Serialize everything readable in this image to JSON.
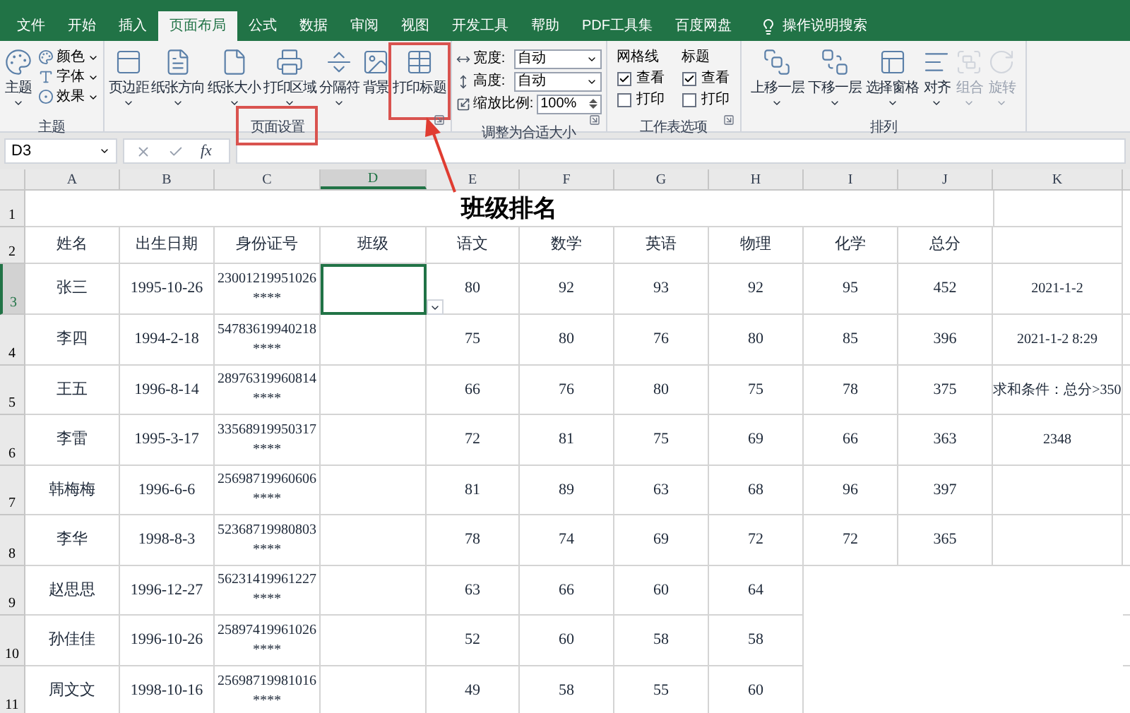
{
  "tabs": [
    {
      "label": "文件",
      "selected": false
    },
    {
      "label": "开始",
      "selected": false
    },
    {
      "label": "插入",
      "selected": false
    },
    {
      "label": "页面布局",
      "selected": true
    },
    {
      "label": "公式",
      "selected": false
    },
    {
      "label": "数据",
      "selected": false
    },
    {
      "label": "审阅",
      "selected": false
    },
    {
      "label": "视图",
      "selected": false
    },
    {
      "label": "开发工具",
      "selected": false
    },
    {
      "label": "帮助",
      "selected": false
    },
    {
      "label": "PDF工具集",
      "selected": false
    },
    {
      "label": "百度网盘",
      "selected": false
    }
  ],
  "tell_me": "操作说明搜索",
  "ribbon": {
    "theme_group": {
      "title": "主题",
      "main": "主题",
      "small": [
        "颜色",
        "字体",
        "效果"
      ]
    },
    "page_setup_group": {
      "title": "页面设置",
      "title_highlighted": true,
      "buttons": [
        {
          "label": "页边距",
          "has_menu": true,
          "highlighted": false
        },
        {
          "label": "纸张方向",
          "has_menu": true,
          "highlighted": false
        },
        {
          "label": "纸张大小",
          "has_menu": true,
          "highlighted": false
        },
        {
          "label": "打印区域",
          "has_menu": true,
          "highlighted": false
        },
        {
          "label": "分隔符",
          "has_menu": true,
          "highlighted": false
        },
        {
          "label": "背景",
          "has_menu": false,
          "highlighted": false
        },
        {
          "label": "打印标题",
          "has_menu": false,
          "highlighted": true
        }
      ]
    },
    "scale_group": {
      "title": "调整为合适大小",
      "fields": [
        {
          "kind": "dropdown",
          "label": "宽度:",
          "value": "自动"
        },
        {
          "kind": "dropdown",
          "label": "高度:",
          "value": "自动"
        },
        {
          "kind": "spinner",
          "label": "缩放比例:",
          "value": "100%"
        }
      ]
    },
    "sheet_options_group": {
      "title": "工作表选项",
      "columns": [
        {
          "title": "网格线",
          "options": [
            {
              "label": "查看",
              "checked": true
            },
            {
              "label": "打印",
              "checked": false
            }
          ]
        },
        {
          "title": "标题",
          "options": [
            {
              "label": "查看",
              "checked": true
            },
            {
              "label": "打印",
              "checked": false
            }
          ]
        }
      ]
    },
    "arrange_group": {
      "title": "排列",
      "buttons": [
        {
          "label": "上移一层",
          "disabled": false
        },
        {
          "label": "下移一层",
          "disabled": false
        },
        {
          "label": "选择窗格",
          "disabled": false
        },
        {
          "label": "对齐",
          "disabled": false
        },
        {
          "label": "组合",
          "disabled": true
        },
        {
          "label": "旋转",
          "disabled": true
        }
      ]
    }
  },
  "formula_bar": {
    "name_box": "D3",
    "fx": "fx"
  },
  "table": {
    "columns": [
      {
        "label": "A",
        "selected": false
      },
      {
        "label": "B",
        "selected": false
      },
      {
        "label": "C",
        "selected": false
      },
      {
        "label": "D",
        "selected": true
      },
      {
        "label": "E",
        "selected": false
      },
      {
        "label": "F",
        "selected": false
      },
      {
        "label": "G",
        "selected": false
      },
      {
        "label": "H",
        "selected": false
      },
      {
        "label": "I",
        "selected": false
      },
      {
        "label": "J",
        "selected": false
      },
      {
        "label": "K",
        "selected": false
      }
    ],
    "title_row": {
      "number": "1",
      "title": "班级排名"
    },
    "header_row": {
      "number": "2",
      "cells": [
        "姓名",
        "出生日期",
        "身份证号",
        "班级",
        "语文",
        "数学",
        "英语",
        "物理",
        "化学",
        "总分"
      ]
    },
    "rows": [
      {
        "number": "3",
        "selected": true,
        "name": "张三",
        "birth_date": "1995-10-26",
        "id_number": "23001219951026\n****",
        "chinese": "80",
        "math": "92",
        "english": "93",
        "physics": "92",
        "chemistry": "95",
        "total": "452",
        "column_k": "2021-1-2"
      },
      {
        "number": "4",
        "selected": false,
        "name": "李四",
        "birth_date": "1994-2-18",
        "id_number": "54783619940218\n****",
        "chinese": "75",
        "math": "80",
        "english": "76",
        "physics": "80",
        "chemistry": "85",
        "total": "396",
        "column_k": "2021-1-2 8:29"
      },
      {
        "number": "5",
        "selected": false,
        "name": "王五",
        "birth_date": "1996-8-14",
        "id_number": "28976319960814\n****",
        "chinese": "66",
        "math": "76",
        "english": "80",
        "physics": "75",
        "chemistry": "78",
        "total": "375",
        "column_k": "求和条件：总分>350"
      },
      {
        "number": "6",
        "selected": false,
        "name": "李雷",
        "birth_date": "1995-3-17",
        "id_number": "33568919950317\n****",
        "chinese": "72",
        "math": "81",
        "english": "75",
        "physics": "69",
        "chemistry": "66",
        "total": "363",
        "column_k": "2348"
      },
      {
        "number": "7",
        "selected": false,
        "name": "韩梅梅",
        "birth_date": "1996-6-6",
        "id_number": "25698719960606\n****",
        "chinese": "81",
        "math": "89",
        "english": "63",
        "physics": "68",
        "chemistry": "96",
        "total": "397"
      },
      {
        "number": "8",
        "selected": false,
        "name": "李华",
        "birth_date": "1998-8-3",
        "id_number": "52368719980803\n****",
        "chinese": "78",
        "math": "74",
        "english": "69",
        "physics": "72",
        "chemistry": "72",
        "total": "365"
      },
      {
        "number": "9",
        "selected": false,
        "name": "赵思思",
        "birth_date": "1996-12-27",
        "id_number": "56231419961227\n****",
        "chinese": "63",
        "math": "66",
        "english": "60",
        "physics": "64"
      },
      {
        "number": "10",
        "selected": false,
        "name": "孙佳佳",
        "birth_date": "1996-10-26",
        "id_number": "25897419961026\n****",
        "chinese": "52",
        "math": "60",
        "english": "58",
        "physics": "58"
      },
      {
        "number": "11",
        "selected": false,
        "name": "周文文",
        "birth_date": "1998-10-16",
        "id_number": "25698719981016\n****",
        "chinese": "49",
        "math": "58",
        "english": "55",
        "physics": "60"
      }
    ]
  }
}
